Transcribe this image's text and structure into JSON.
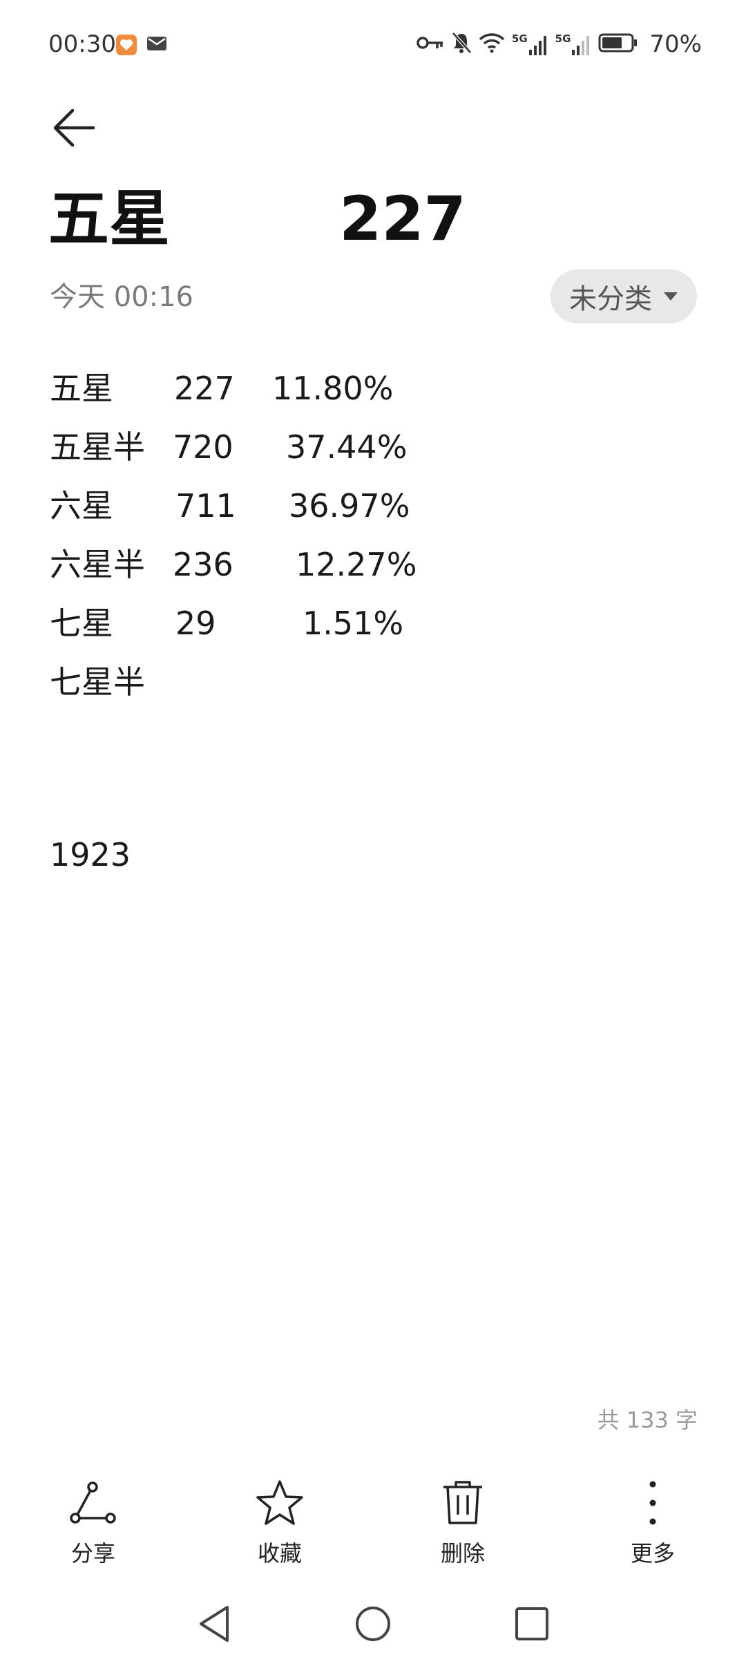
{
  "status_bar": {
    "time": "00:30",
    "signal_5g_a": "5G",
    "signal_5g_b": "5G",
    "battery": "70%"
  },
  "note": {
    "title": "五星        227",
    "date": "今天 00:16",
    "category": "未分类",
    "rows": [
      {
        "name": "五星",
        "count": "227",
        "pct": "11.80%"
      },
      {
        "name": "五星半",
        "count": "720",
        "pct": "37.44%"
      },
      {
        "name": "六星",
        "count": "711",
        "pct": "36.97%"
      },
      {
        "name": "六星半",
        "count": "236",
        "pct": "12.27%"
      },
      {
        "name": "七星",
        "count": "29",
        "pct": "1.51%"
      },
      {
        "name": "七星半",
        "count": "",
        "pct": ""
      }
    ],
    "total": "1923",
    "word_count": "共 133 字"
  },
  "toolbar": {
    "share": "分享",
    "favorite": "收藏",
    "delete": "删除",
    "more": "更多"
  },
  "icons": {
    "back": "arrow-left-icon",
    "share": "share-icon",
    "favorite": "star-icon",
    "delete": "trash-icon",
    "more": "more-vertical-icon",
    "nav_back": "triangle-back-icon",
    "nav_home": "circle-home-icon",
    "nav_recent": "square-recent-icon"
  },
  "colors": {
    "notif_icon": "#f08a3c",
    "chip_bg": "#e8e8e8"
  }
}
